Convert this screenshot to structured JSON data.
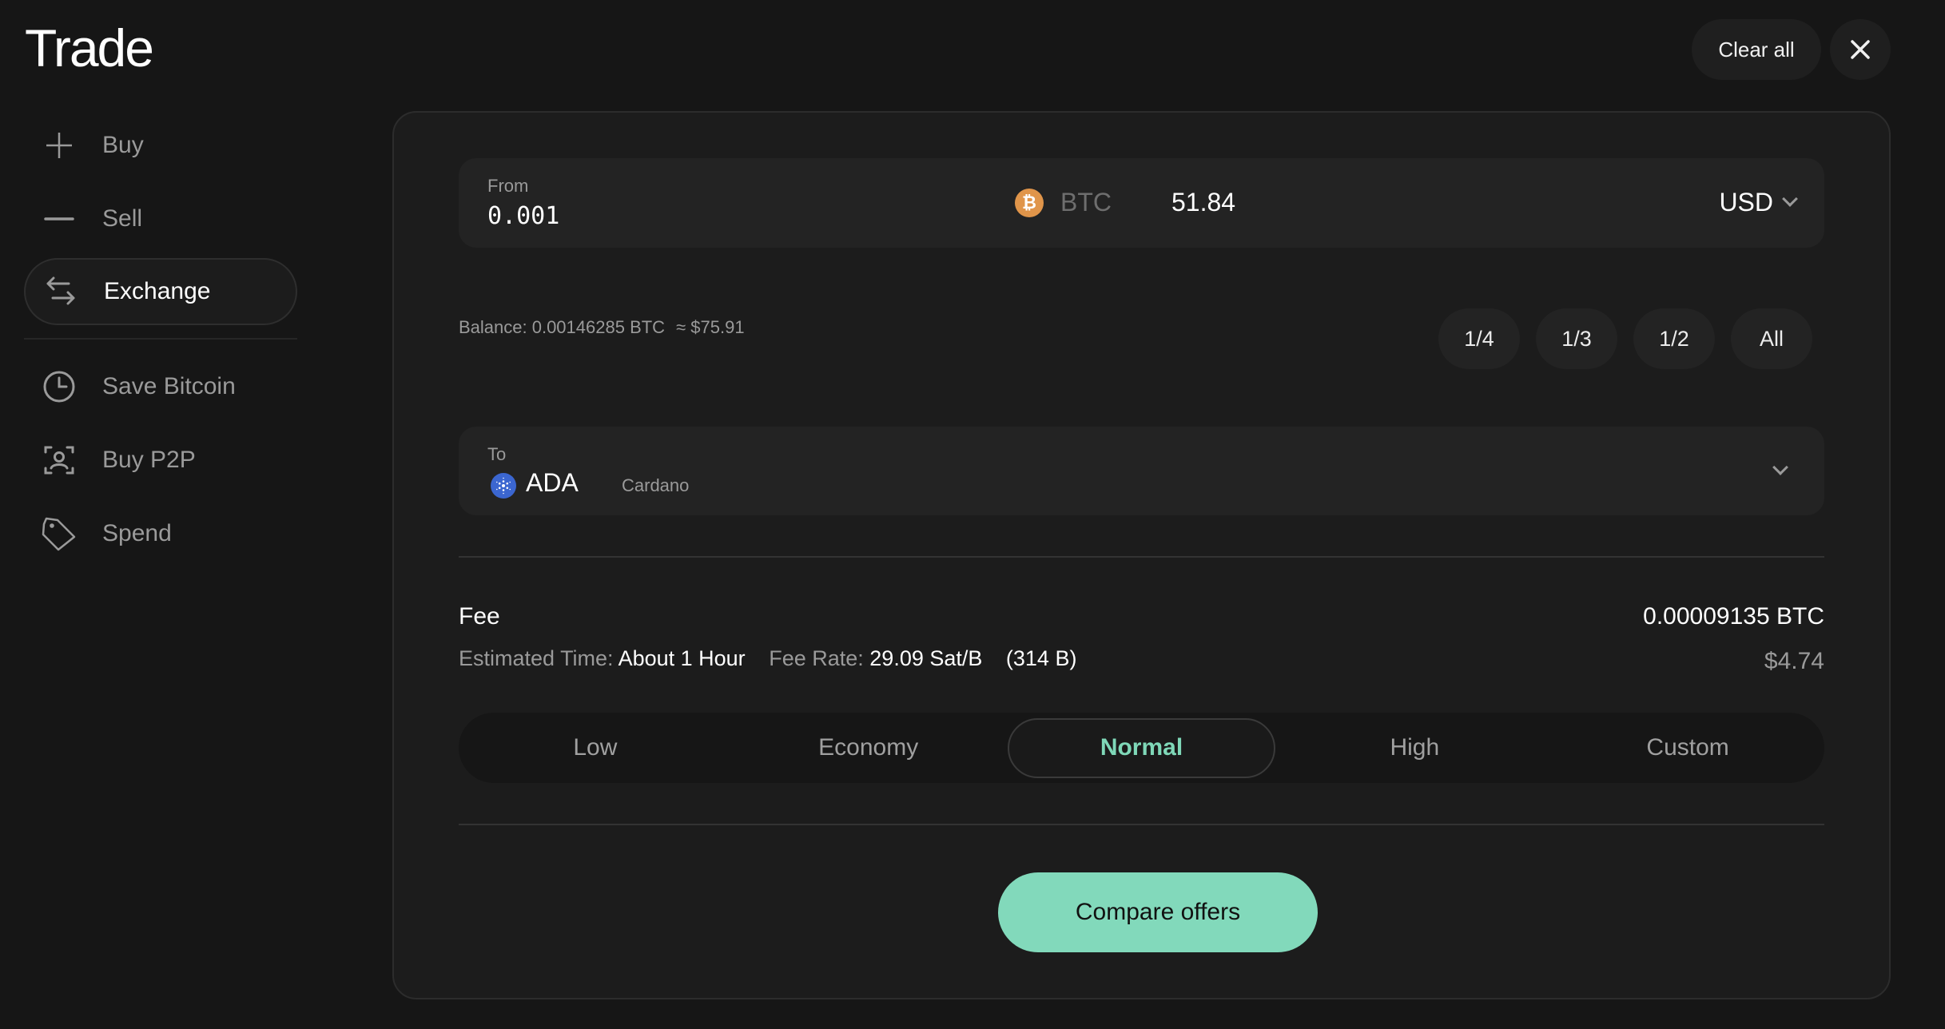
{
  "page": {
    "title": "Trade"
  },
  "header": {
    "clear_all_label": "Clear all"
  },
  "sidebar": {
    "items": [
      {
        "label": "Buy",
        "icon": "plus-icon",
        "active": false
      },
      {
        "label": "Sell",
        "icon": "minus-icon",
        "active": false
      },
      {
        "label": "Exchange",
        "icon": "swap-arrows-icon",
        "active": true
      },
      {
        "label": "Save Bitcoin",
        "icon": "clock-icon",
        "active": false
      },
      {
        "label": "Buy P2P",
        "icon": "user-scan-icon",
        "active": false
      },
      {
        "label": "Spend",
        "icon": "tag-icon",
        "active": false
      }
    ]
  },
  "from": {
    "label": "From",
    "amount": "0.001",
    "currency": "BTC",
    "coin_icon": "bitcoin-icon",
    "fiat_value": "51.84",
    "fiat_currency": "USD"
  },
  "balance": {
    "text": "Balance: 0.00146285 BTC",
    "approx": "≈ $75.91"
  },
  "fraction_buttons": [
    "1/4",
    "1/3",
    "1/2",
    "All"
  ],
  "to": {
    "label": "To",
    "symbol": "ADA",
    "name": "Cardano",
    "coin_icon": "cardano-icon"
  },
  "fee": {
    "title": "Fee",
    "amount_btc": "0.00009135 BTC",
    "amount_usd": "$4.74",
    "estimated_time_label": "Estimated Time:",
    "estimated_time_value": "About 1 Hour",
    "fee_rate_label": "Fee Rate:",
    "fee_rate_value": "29.09 Sat/B",
    "size": "(314 B)"
  },
  "fee_levels": {
    "options": [
      "Low",
      "Economy",
      "Normal",
      "High",
      "Custom"
    ],
    "selected": "Normal"
  },
  "actions": {
    "compare_label": "Compare offers"
  },
  "colors": {
    "accent": "#82d9bb",
    "accent_text": "#7fd8b8",
    "bitcoin": "#e0954a",
    "cardano": "#3b66d0",
    "background": "#161616",
    "panel": "#1c1c1c"
  }
}
